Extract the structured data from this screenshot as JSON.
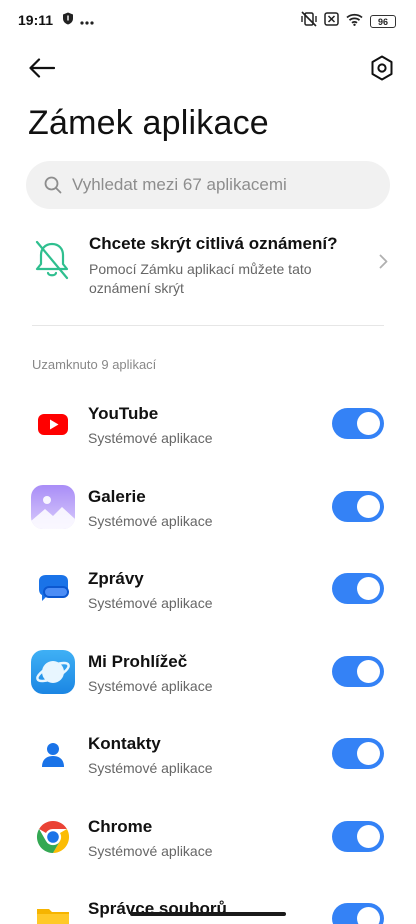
{
  "status_bar": {
    "time": "19:11",
    "battery": "96"
  },
  "header": {
    "title": "Zámek aplikace"
  },
  "search": {
    "placeholder": "Vyhledat mezi 67 aplikacemi"
  },
  "notice": {
    "title": "Chcete skrýt citlivá oznámení?",
    "description": "Pomocí Zámku aplikací můžete tato oznámení skrýt"
  },
  "section": {
    "label": "Uzamknuto 9 aplikací"
  },
  "apps": [
    {
      "name": "YouTube",
      "subtitle": "Systémové aplikace",
      "icon": "youtube-icon",
      "locked": true
    },
    {
      "name": "Galerie",
      "subtitle": "Systémové aplikace",
      "icon": "gallery-icon",
      "locked": true
    },
    {
      "name": "Zprávy",
      "subtitle": "Systémové aplikace",
      "icon": "messages-icon",
      "locked": true
    },
    {
      "name": "Mi Prohlížeč",
      "subtitle": "Systémové aplikace",
      "icon": "mi-browser-icon",
      "locked": true
    },
    {
      "name": "Kontakty",
      "subtitle": "Systémové aplikace",
      "icon": "contacts-icon",
      "locked": true
    },
    {
      "name": "Chrome",
      "subtitle": "Systémové aplikace",
      "icon": "chrome-icon",
      "locked": true
    },
    {
      "name": "Správce souborů",
      "subtitle": "",
      "icon": "file-manager-icon",
      "locked": true
    }
  ],
  "colors": {
    "toggle_on": "#3482f6",
    "notice_icon": "#2fbf8f"
  }
}
